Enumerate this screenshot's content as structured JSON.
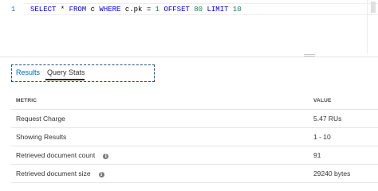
{
  "editor": {
    "line_number": "1",
    "code": {
      "t1": "SELECT",
      "t2": " * ",
      "t3": "FROM",
      "t4": " c ",
      "t5": "WHERE",
      "t6": " c.pk = ",
      "t7": "1",
      "t8": " ",
      "t9": "OFFSET",
      "t10": " ",
      "t11": "80",
      "t12": " ",
      "t13": "LIMIT",
      "t14": " ",
      "t15": "10"
    }
  },
  "tabs": {
    "results_label": "Results",
    "query_stats_label": "Query Stats",
    "active": "Query Stats"
  },
  "table": {
    "headers": {
      "metric": "METRIC",
      "value": "VALUE"
    },
    "rows": [
      {
        "metric": "Request Charge",
        "value": "5.47 RUs",
        "info": false
      },
      {
        "metric": "Showing Results",
        "value": "1 - 10",
        "info": false
      },
      {
        "metric": "Retrieved document count",
        "value": "91",
        "info": true
      },
      {
        "metric": "Retrieved document size",
        "value": "29240 bytes",
        "info": true
      }
    ]
  },
  "icons": {
    "info": "info-icon"
  },
  "colors": {
    "keyword": "#0000ff",
    "number": "#098658",
    "line_number": "#237893",
    "link": "#0063b1"
  }
}
